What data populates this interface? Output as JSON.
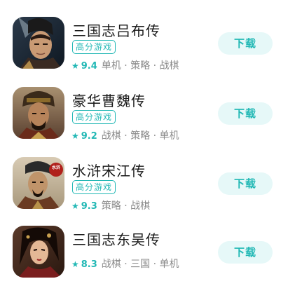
{
  "games": [
    {
      "name": "三国志吕布传",
      "tag": "高分游戏",
      "rating": "9.4",
      "categories": "单机 · 策略 · 战棋",
      "download_label": "下载",
      "icon": "lu-bu-portrait"
    },
    {
      "name": "豪华曹魏传",
      "tag": "高分游戏",
      "rating": "9.2",
      "categories": "战棋 · 策略 · 单机",
      "download_label": "下载",
      "icon": "cao-cao-portrait"
    },
    {
      "name": "水浒宋江传",
      "tag": "高分游戏",
      "rating": "9.3",
      "categories": "策略 · 战棋",
      "download_label": "下载",
      "icon": "song-jiang-portrait",
      "icon_seal_text": "水浒"
    },
    {
      "name": "三国志东吴传",
      "tag": "",
      "rating": "8.3",
      "categories": "战棋 · 三国 · 单机",
      "download_label": "下载",
      "icon": "wu-heroine-portrait"
    }
  ],
  "colors": {
    "accent": "#22b8b5",
    "button_bg": "#e6f8f8",
    "title": "#1a1a1a",
    "meta": "#8a8a8a"
  }
}
